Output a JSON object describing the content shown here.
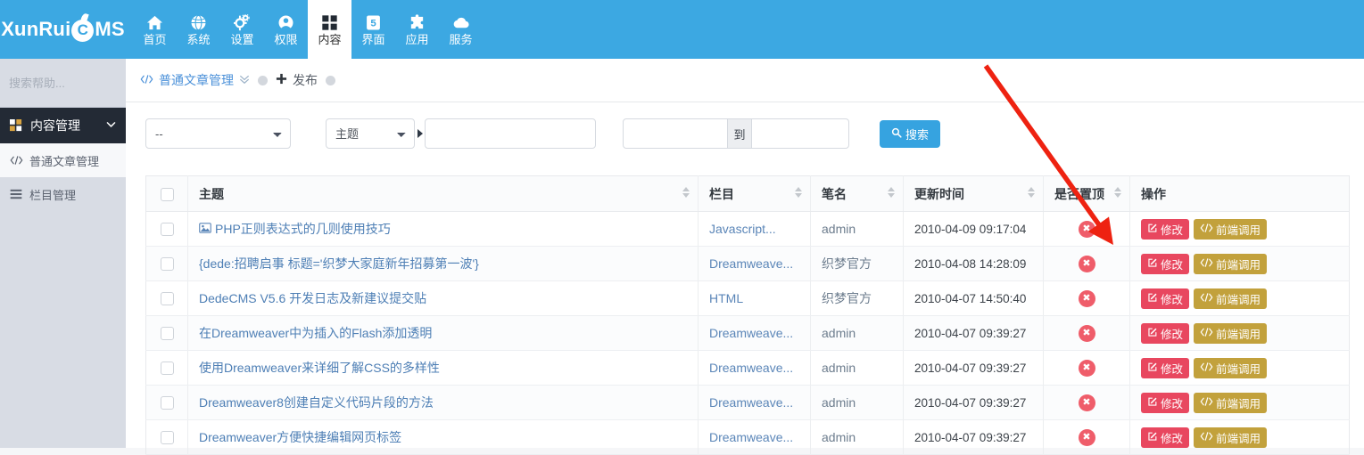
{
  "brand": {
    "name_pre": "XunRui",
    "flame_letter": "C",
    "name_post": "MS"
  },
  "topnav": {
    "items": [
      {
        "label": "首页",
        "icon": "home-icon"
      },
      {
        "label": "系统",
        "icon": "globe-icon"
      },
      {
        "label": "设置",
        "icon": "gears-icon"
      },
      {
        "label": "权限",
        "icon": "user-circle-icon"
      },
      {
        "label": "内容",
        "icon": "grid-icon",
        "active": true
      },
      {
        "label": "界面",
        "icon": "html5-icon"
      },
      {
        "label": "应用",
        "icon": "puzzle-icon"
      },
      {
        "label": "服务",
        "icon": "cloud-icon"
      }
    ]
  },
  "sidebar": {
    "search_placeholder": "搜索帮助...",
    "search_value": "",
    "group": {
      "label": "内容管理",
      "icon": "grid-icon",
      "chevron": "chevron-down-icon"
    },
    "items": [
      {
        "label": "普通文章管理",
        "icon": "code-icon",
        "active": true
      },
      {
        "label": "栏目管理",
        "icon": "list-icon",
        "active": false
      }
    ]
  },
  "breadcrumb": {
    "tab_label": "普通文章管理",
    "tab_icon": "code-icon",
    "publish_label": "发布",
    "publish_icon": "plus-icon"
  },
  "filter": {
    "category_value": "--",
    "field_value": "主题",
    "keyword_value": "",
    "keyword_placeholder": "",
    "date_from_value": "",
    "date_to_value": "",
    "date_separator": "到",
    "search_label": "搜索",
    "search_icon": "search-icon"
  },
  "table": {
    "columns": [
      {
        "label": "",
        "sortable": false
      },
      {
        "label": "主题",
        "sortable": true
      },
      {
        "label": "栏目",
        "sortable": true
      },
      {
        "label": "笔名",
        "sortable": true
      },
      {
        "label": "更新时间",
        "sortable": true
      },
      {
        "label": "是否置顶",
        "sortable": true
      },
      {
        "label": "操作",
        "sortable": false
      }
    ],
    "actions": {
      "edit_label": "修改",
      "edit_icon": "pencil-square-icon",
      "front_label": "前端调用",
      "front_icon": "code-icon",
      "top_icon": "circle-x-icon"
    },
    "rows": [
      {
        "title": "PHP正则表达式的几则使用技巧",
        "has_thumb": true,
        "category": "Javascript...",
        "pen": "admin",
        "time": "2010-04-09 09:17:04"
      },
      {
        "title": "{dede:招聘启事 标题='织梦大家庭新年招募第一波'}",
        "has_thumb": false,
        "category": "Dreamweave...",
        "pen": "织梦官方",
        "time": "2010-04-08 14:28:09"
      },
      {
        "title": "DedeCMS V5.6 开发日志及新建议提交贴",
        "has_thumb": false,
        "category": "HTML",
        "pen": "织梦官方",
        "time": "2010-04-07 14:50:40"
      },
      {
        "title": "在Dreamweaver中为插入的Flash添加透明",
        "has_thumb": false,
        "category": "Dreamweave...",
        "pen": "admin",
        "time": "2010-04-07 09:39:27"
      },
      {
        "title": "使用Dreamweaver来详细了解CSS的多样性",
        "has_thumb": false,
        "category": "Dreamweave...",
        "pen": "admin",
        "time": "2010-04-07 09:39:27"
      },
      {
        "title": "Dreamweaver8创建自定义代码片段的方法",
        "has_thumb": false,
        "category": "Dreamweave...",
        "pen": "admin",
        "time": "2010-04-07 09:39:27"
      },
      {
        "title": "Dreamweaver方便快捷编辑网页标签",
        "has_thumb": false,
        "category": "Dreamweave...",
        "pen": "admin",
        "time": "2010-04-07 09:39:27"
      }
    ]
  },
  "annotation": {
    "arrow_color": "#ee2211"
  },
  "colors": {
    "header_blue": "#3ca8e2",
    "sidebar_bg": "#d8dce4",
    "sidebar_group_bg": "#232a35",
    "accent_button": "#36a3e0",
    "edit_button": "#e8475f",
    "front_button": "#c2a13c",
    "delete_circle": "#ef5d6a"
  }
}
